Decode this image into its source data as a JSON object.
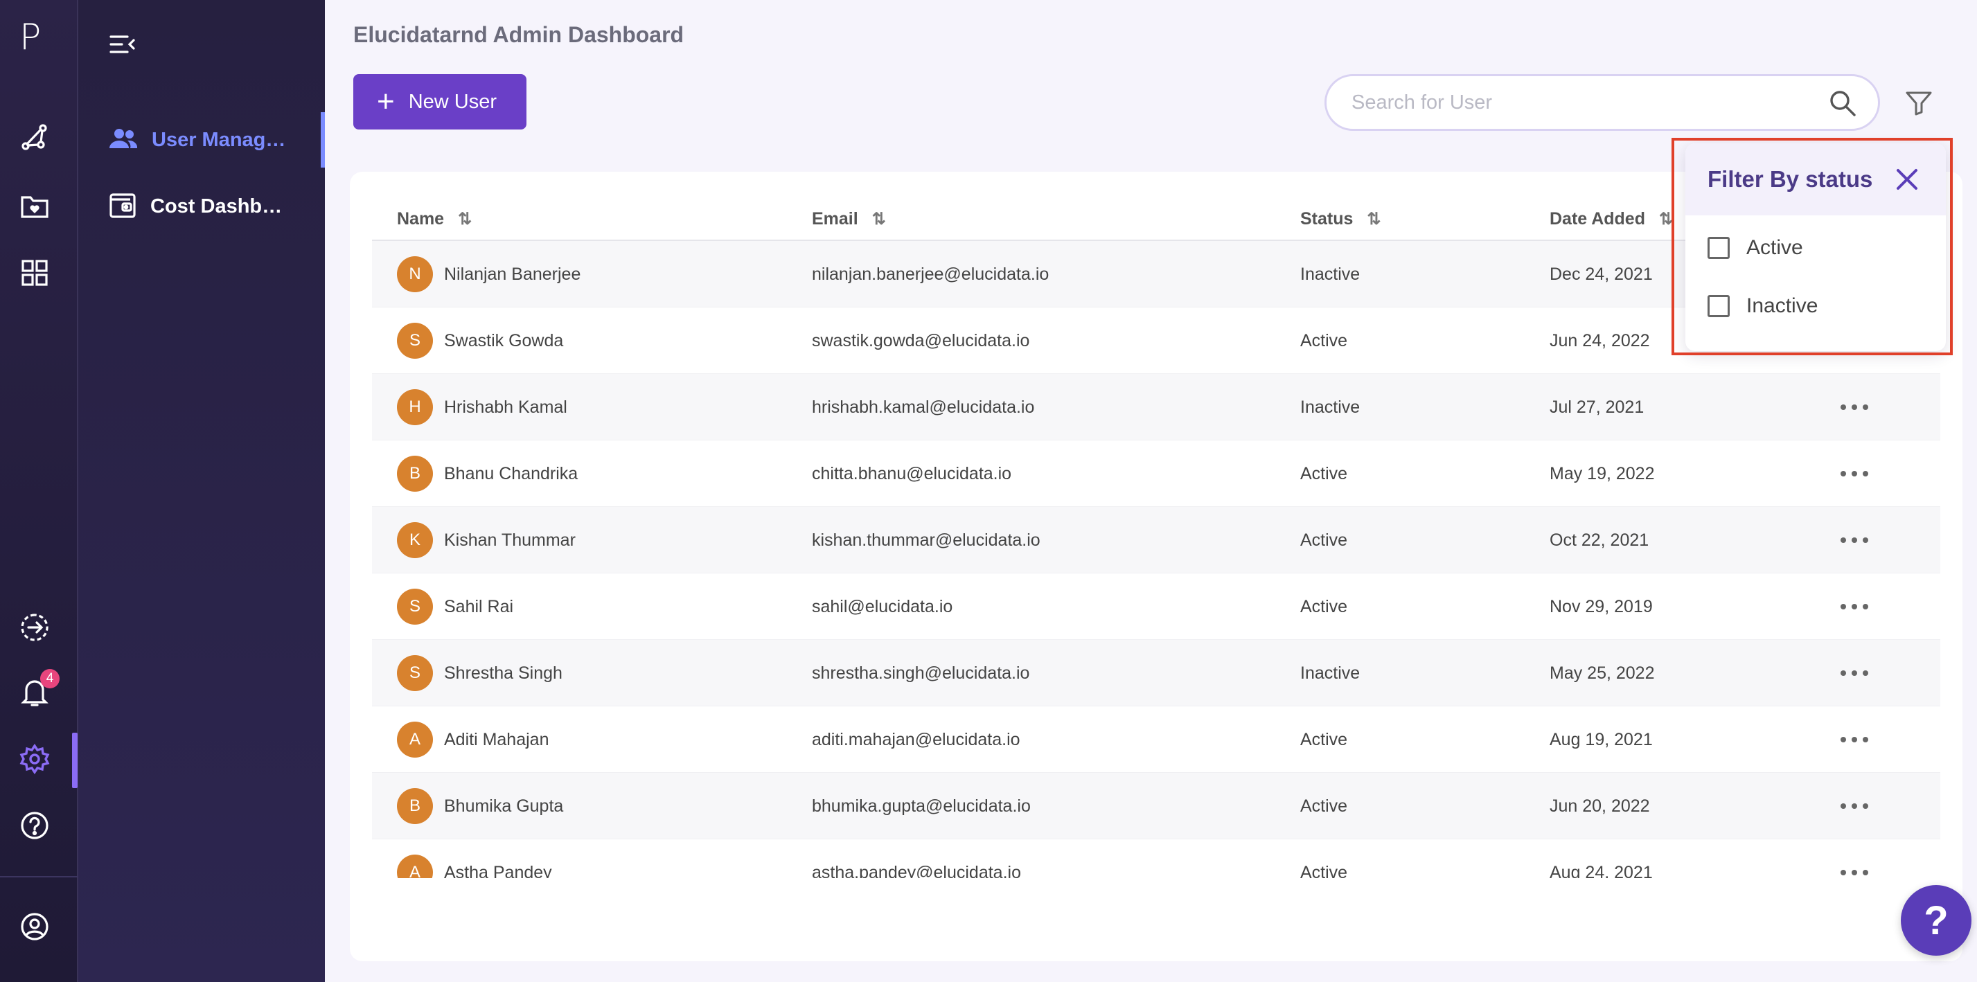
{
  "rail": {
    "logo": "P",
    "notification_count": "4"
  },
  "sidebar": {
    "items": [
      {
        "label": "User Manage...",
        "icon": "users-icon"
      },
      {
        "label": "Cost Dashbo...",
        "icon": "wallet-icon"
      }
    ]
  },
  "header": {
    "title": "Elucidatarnd Admin Dashboard",
    "new_user_label": "New User",
    "search_placeholder": "Search for User"
  },
  "table": {
    "columns": [
      "Name",
      "Email",
      "Status",
      "Date Added"
    ],
    "rows": [
      {
        "initial": "N",
        "name": "Nilanjan Banerjee",
        "email": "nilanjan.banerjee@elucidata.io",
        "status": "Inactive",
        "date": "Dec 24, 2021"
      },
      {
        "initial": "S",
        "name": "Swastik Gowda",
        "email": "swastik.gowda@elucidata.io",
        "status": "Active",
        "date": "Jun 24, 2022"
      },
      {
        "initial": "H",
        "name": "Hrishabh Kamal",
        "email": "hrishabh.kamal@elucidata.io",
        "status": "Inactive",
        "date": "Jul 27, 2021"
      },
      {
        "initial": "B",
        "name": "Bhanu Chandrika",
        "email": "chitta.bhanu@elucidata.io",
        "status": "Active",
        "date": "May 19, 2022"
      },
      {
        "initial": "K",
        "name": "Kishan Thummar",
        "email": "kishan.thummar@elucidata.io",
        "status": "Active",
        "date": "Oct 22, 2021"
      },
      {
        "initial": "S",
        "name": "Sahil Rai",
        "email": "sahil@elucidata.io",
        "status": "Active",
        "date": "Nov 29, 2019"
      },
      {
        "initial": "S",
        "name": "Shrestha Singh",
        "email": "shrestha.singh@elucidata.io",
        "status": "Inactive",
        "date": "May 25, 2022"
      },
      {
        "initial": "A",
        "name": "Aditi Mahajan",
        "email": "aditi.mahajan@elucidata.io",
        "status": "Active",
        "date": "Aug 19, 2021"
      },
      {
        "initial": "B",
        "name": "Bhumika Gupta",
        "email": "bhumika.gupta@elucidata.io",
        "status": "Active",
        "date": "Jun 20, 2022"
      },
      {
        "initial": "A",
        "name": "Astha Pandey",
        "email": "astha.pandey@elucidata.io",
        "status": "Active",
        "date": "Aug 24, 2021"
      }
    ]
  },
  "filter": {
    "title": "Filter By status",
    "options": [
      "Active",
      "Inactive"
    ]
  },
  "help_fab": "?",
  "colors": {
    "primary": "#6a3fc7",
    "avatar": "#d8822e",
    "active_nav": "#7b8cff",
    "highlight": "#e0402a"
  }
}
